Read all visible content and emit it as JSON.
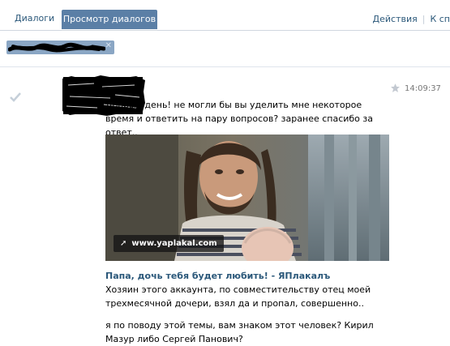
{
  "tabs": {
    "dialogs": "Диалоги",
    "view_dialogs": "Просмотр диалогов"
  },
  "actions": {
    "actions_label": "Действия",
    "back_label": "К сп"
  },
  "message": {
    "time": "14:09:37",
    "text": "Добрый день! не могли бы вы уделить мне некоторое время и ответить на пару вопросов? заранее спасибо за ответ..",
    "snippet": {
      "link_domain": "www.yaplakal.com",
      "title": "Папа, дочь тебя будет любить! - ЯПлакалъ",
      "description": "Хозяин этого аккаунта, по совместительству отец моей трехмесячной дочери, взял да и пропал, совершенно.."
    },
    "text2": "я по поводу этой темы, вам знаком этот человек? Кирил Мазур либо Сергей Панович?"
  },
  "colors": {
    "link": "#2b587a",
    "active_tab": "#5b7fa6",
    "token": "#8aa6c4"
  },
  "icons": [
    "read-check-icon",
    "star-icon",
    "link-arrow-icon",
    "close-icon"
  ]
}
